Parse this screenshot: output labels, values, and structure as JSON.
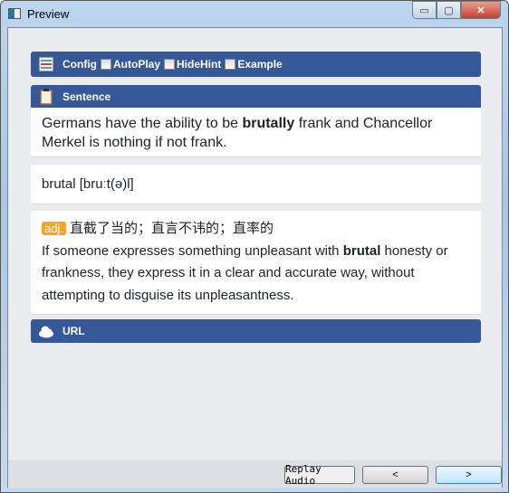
{
  "window": {
    "title": "Preview",
    "controls": {
      "minimize": "▭",
      "maximize": "▢",
      "close": "✕"
    }
  },
  "config": {
    "label": "Config",
    "options": [
      {
        "label": "AutoPlay",
        "checked": false
      },
      {
        "label": "HideHint",
        "checked": false
      },
      {
        "label": "Example",
        "checked": false
      }
    ]
  },
  "sentence": {
    "label": "Sentence",
    "before": "Germans have the ability to be ",
    "bold": "brutally",
    "after": " frank and Chancellor Merkel is nothing if not frank."
  },
  "word": {
    "text": "brutal [bruːt(ə)l]"
  },
  "definition": {
    "pos": "adj.",
    "chinese": "直截了当的；直言不讳的；直率的",
    "before": "If someone expresses something unpleasant with ",
    "bold": "brutal",
    "after": " honesty or frankness, they express it in a clear and accurate way, without attempting to disguise its unpleasantness."
  },
  "url": {
    "label": "URL"
  },
  "buttons": {
    "replay": "Replay Audio",
    "prev": "<",
    "next": ">"
  },
  "colors": {
    "header": "#365899",
    "badge": "#f5a623"
  }
}
